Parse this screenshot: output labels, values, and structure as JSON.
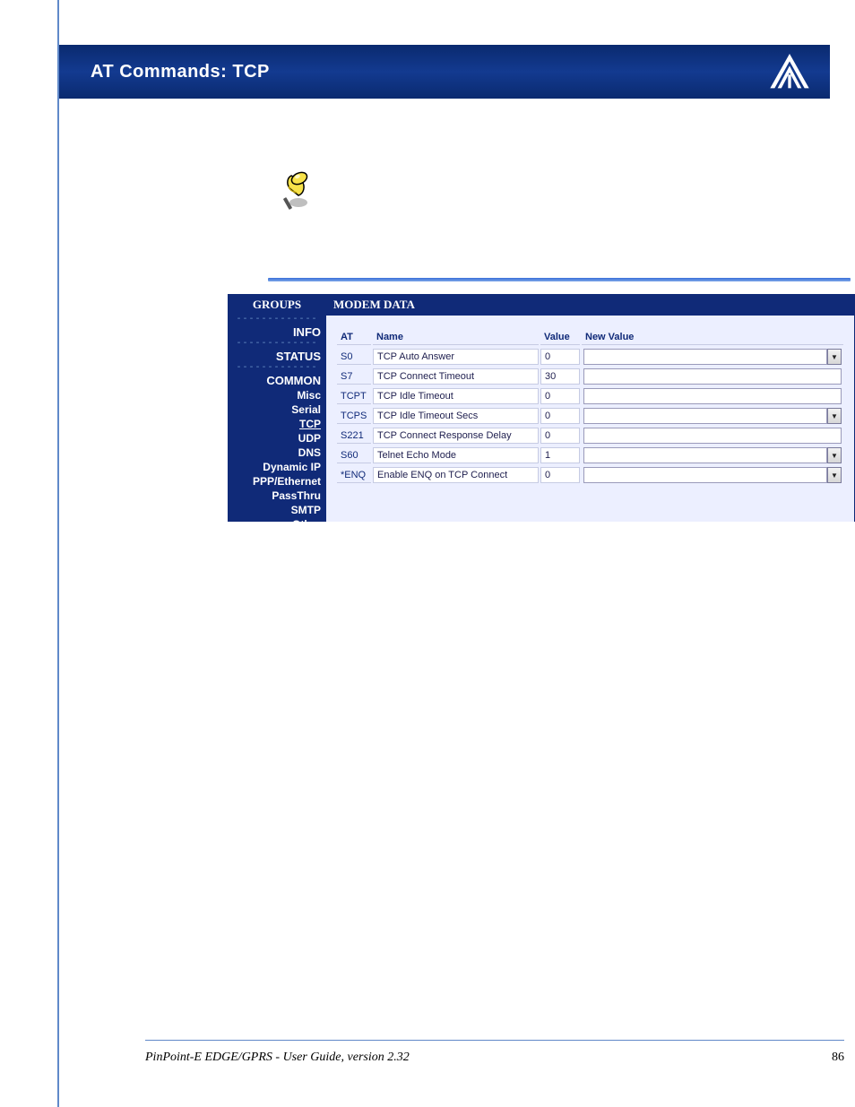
{
  "header": {
    "title": "AT Commands: TCP"
  },
  "config": {
    "groups_header": "GROUPS",
    "modem_header": "MODEM DATA",
    "group_sep": "-------------",
    "groups_top": [
      {
        "label": "INFO"
      },
      {
        "label": "STATUS"
      },
      {
        "label": "COMMON"
      }
    ],
    "groups_sub": [
      {
        "label": "Misc"
      },
      {
        "label": "Serial"
      },
      {
        "label": "TCP",
        "active": true
      },
      {
        "label": "UDP"
      },
      {
        "label": "DNS"
      },
      {
        "label": "Dynamic IP"
      },
      {
        "label": "PPP/Ethernet"
      },
      {
        "label": "PassThru"
      },
      {
        "label": "SMTP"
      },
      {
        "label": "Other"
      }
    ],
    "columns": {
      "at": "AT",
      "name": "Name",
      "value": "Value",
      "newvalue": "New Value"
    },
    "rows": [
      {
        "at": "S0",
        "name": "TCP Auto Answer",
        "value": "0",
        "dropdown": true
      },
      {
        "at": "S7",
        "name": "TCP Connect Timeout",
        "value": "30",
        "dropdown": false
      },
      {
        "at": "TCPT",
        "name": "TCP Idle Timeout",
        "value": "0",
        "dropdown": false
      },
      {
        "at": "TCPS",
        "name": "TCP Idle Timeout Secs",
        "value": "0",
        "dropdown": true
      },
      {
        "at": "S221",
        "name": "TCP Connect Response Delay",
        "value": "0",
        "dropdown": false
      },
      {
        "at": "S60",
        "name": "Telnet Echo Mode",
        "value": "1",
        "dropdown": true
      },
      {
        "at": "*ENQ",
        "name": "Enable ENQ on TCP Connect",
        "value": "0",
        "dropdown": true
      }
    ]
  },
  "footer": {
    "left": "PinPoint-E EDGE/GPRS - User Guide, version 2.32",
    "page": "86"
  }
}
